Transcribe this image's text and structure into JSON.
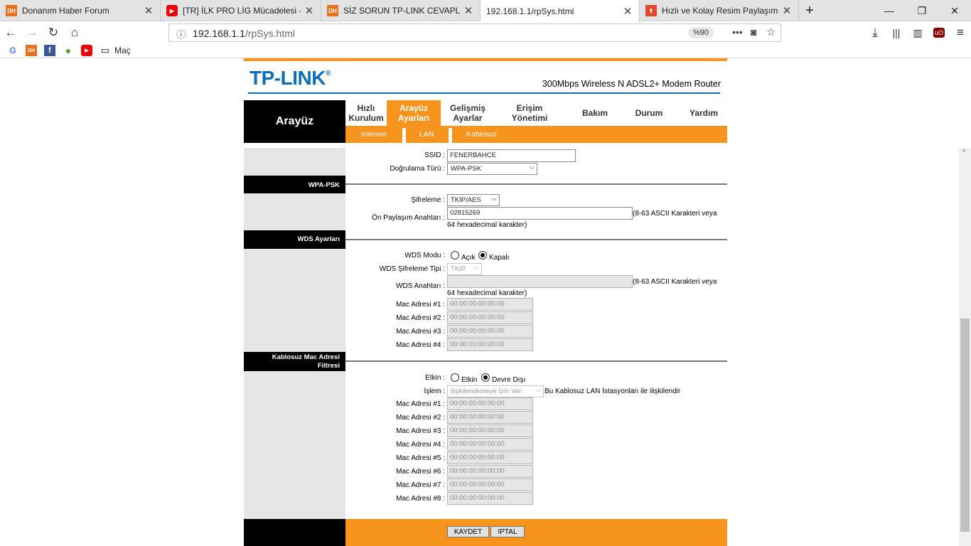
{
  "browser": {
    "tabs": [
      {
        "title": "Donanım Haber Forum",
        "favicon": "dh-icon"
      },
      {
        "title": "[TR] İLK PRO LİG Mücadelesi - S",
        "favicon": "youtube-icon"
      },
      {
        "title": "SİZ SORUN TP-LINK CEVAPLASIN",
        "favicon": "dh-icon"
      },
      {
        "title": "192.168.1.1/rpSys.html",
        "favicon": ""
      },
      {
        "title": "Hızlı ve Kolay Resim Paylaşımı",
        "favicon": "upload-icon"
      }
    ],
    "new_tab": "+",
    "url_host": "192.168.1.1",
    "url_path": "/rpSys.html",
    "zoom": "%90",
    "bookmarks": [
      {
        "icon": "google-icon",
        "label": ""
      },
      {
        "icon": "dh-icon",
        "label": ""
      },
      {
        "icon": "facebook-icon",
        "label": ""
      },
      {
        "icon": "droplet-icon",
        "label": ""
      },
      {
        "icon": "youtube-icon",
        "label": ""
      },
      {
        "icon": "folder-icon",
        "label": "Maç"
      }
    ]
  },
  "router": {
    "logo": "TP-LINK",
    "model": "300Mbps Wireless N ADSL2+ Modem Router",
    "section_title": "Arayüz",
    "menu": [
      "Hızlı Kurulum",
      "Arayüz Ayarları",
      "Gelişmiş Ayarlar",
      "Erişim Yönetimi",
      "Bakım",
      "Durum",
      "Yardım"
    ],
    "submenu": [
      "Internet",
      "LAN",
      "Kablosuz"
    ],
    "wireless": {
      "ssid_label": "SSID :",
      "ssid_value": "FENERBAHCE",
      "auth_label": "Doğrulama Türü :",
      "auth_value": "WPA-PSK"
    },
    "wpa": {
      "header": "WPA-PSK",
      "enc_label": "Şifreleme :",
      "enc_value": "TKIP/AES",
      "psk_label": "Ön Paylaşım Anahtarı :",
      "psk_value": "02815269",
      "psk_hint": "(8-63 ASCII Karakteri veya",
      "psk_hint2": "64 hexadecimal karakter)"
    },
    "wds": {
      "header": "WDS Ayarları",
      "mode_label": "WDS Modu :",
      "mode_on": "Açık",
      "mode_off": "Kapalı",
      "enc_label": "WDS Şifreleme Tipi :",
      "enc_value": "TKIP",
      "key_label": "WDS Anahtarı :",
      "key_hint": "(8-63 ASCII Karakteri veya",
      "key_hint2": "64 hexadecimal karakter)",
      "mac_labels": [
        "Mac Adresi #1 :",
        "Mac Adresi #2 :",
        "Mac Adresi #3 :",
        "Mac Adresi #4 :"
      ],
      "mac_placeholder": "00:00:00:00:00:00"
    },
    "macfilter": {
      "header1": "Kablosuz Mac Adresi",
      "header2": "Filtresi",
      "active_label": "Etkin :",
      "active_on": "Etkin",
      "active_off": "Devre Dışı",
      "action_label": "İşlem :",
      "action_value": "İlişkilendirmeye İzin Ver",
      "action_desc": "Bu Kablosuz LAN İstasyonları ile ilişkilendir",
      "mac_labels": [
        "Mac Adresi #1 :",
        "Mac Adresi #2 :",
        "Mac Adresi #3 :",
        "Mac Adresi #4 :",
        "Mac Adresi #5 :",
        "Mac Adresi #6 :",
        "Mac Adresi #7 :",
        "Mac Adresi #8 :"
      ],
      "mac_placeholder": "00:00:00:00:00:00"
    },
    "buttons": {
      "save": "KAYDET",
      "cancel": "IPTAL"
    }
  }
}
